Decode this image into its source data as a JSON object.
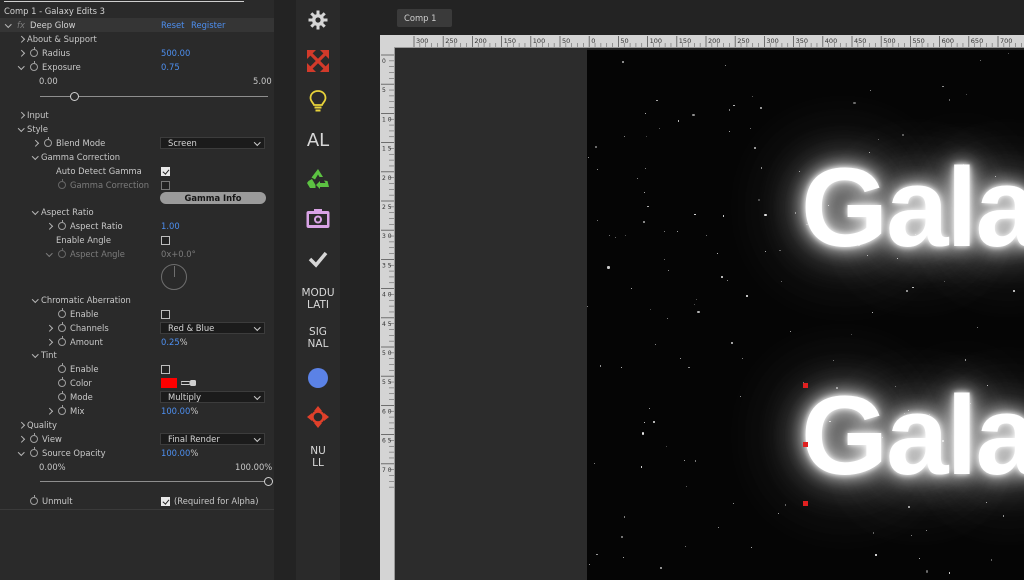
{
  "effect_panel": {
    "comp_title": "Comp 1 - Galaxy Edits 3",
    "fx_glyph": "fx",
    "effect_name": "Deep Glow",
    "reset_label": "Reset",
    "register_label": "Register",
    "about_label": "About & Support",
    "radius_label": "Radius",
    "radius_value": "500.00",
    "exposure_label": "Exposure",
    "exposure_value": "0.75",
    "exposure_min": "0.00",
    "exposure_max": "5.00",
    "exposure_slider_fraction": 0.15,
    "input_label": "Input",
    "style_label": "Style",
    "blend_mode_label": "Blend Mode",
    "blend_mode_value": "Screen",
    "gamma_correction_group": "Gamma Correction",
    "auto_detect_gamma_label": "Auto Detect Gamma",
    "auto_detect_gamma_checked": true,
    "gamma_correction_label": "Gamma Correction",
    "gamma_info_button": "Gamma Info",
    "aspect_ratio_group": "Aspect Ratio",
    "aspect_ratio_label": "Aspect Ratio",
    "aspect_ratio_value": "1.00",
    "enable_angle_label": "Enable Angle",
    "aspect_angle_label": "Aspect Angle",
    "aspect_angle_value": "0x+0.0°",
    "chromatic_group": "Chromatic Aberration",
    "ca_enable_label": "Enable",
    "channels_label": "Channels",
    "channels_value": "Red & Blue",
    "amount_label": "Amount",
    "amount_value": "0.25",
    "amount_unit": "%",
    "tint_group": "Tint",
    "tint_enable_label": "Enable",
    "color_label": "Color",
    "tint_color": "#ff0000",
    "mode_label": "Mode",
    "mode_value": "Multiply",
    "mix_label": "Mix",
    "mix_value": "100.00",
    "mix_unit": "%",
    "quality_label": "Quality",
    "view_label": "View",
    "view_value": "Final Render",
    "source_opacity_label": "Source Opacity",
    "source_opacity_value": "100.00",
    "source_opacity_unit": "%",
    "opacity_min": "0.00%",
    "opacity_max": "100.00%",
    "opacity_slider_fraction": 1.0,
    "unmult_label": "Unmult",
    "unmult_note": "(Required for Alpha)",
    "unmult_checked": true
  },
  "toolbar": {
    "items": [
      {
        "icon": "gear-icon"
      },
      {
        "icon": "red-expand-arrows-icon",
        "color": "#d23a2a"
      },
      {
        "icon": "lightbulb-icon",
        "color": "#e7d23a"
      },
      {
        "label": "AL"
      },
      {
        "icon": "recycle-icon",
        "color": "#5cc242"
      },
      {
        "icon": "camera-screenshot-icon",
        "color": "#d9a3e6"
      },
      {
        "icon": "checkmark-icon"
      },
      {
        "label_line1": "MODU",
        "label_line2": "LATI"
      },
      {
        "label_line1": "SIG",
        "label_line2": "NAL"
      },
      {
        "icon": "blue-circle-icon",
        "color": "#5b82e6"
      },
      {
        "icon": "red-target-arrows-icon",
        "color": "#e0402a"
      },
      {
        "label_line1": "NU",
        "label_line2": "LL"
      }
    ]
  },
  "viewer": {
    "tab_label": "Comp 1",
    "ruler_top_labels": [
      "300",
      "250",
      "200",
      "150",
      "100",
      "50",
      "0",
      "50",
      "100",
      "150",
      "200",
      "250",
      "300",
      "350",
      "400",
      "450",
      "500",
      "550",
      "600",
      "650",
      "700"
    ],
    "ruler_left_labels": [
      "0",
      "5",
      "1 0",
      "1 5",
      "2 0",
      "2 5",
      "3 0",
      "3 5",
      "4 0",
      "4 5",
      "5 0",
      "5 5",
      "6 0",
      "6 5",
      "7 0"
    ],
    "canvas_text_line1": "Gala",
    "canvas_text_line2": "Gala"
  }
}
